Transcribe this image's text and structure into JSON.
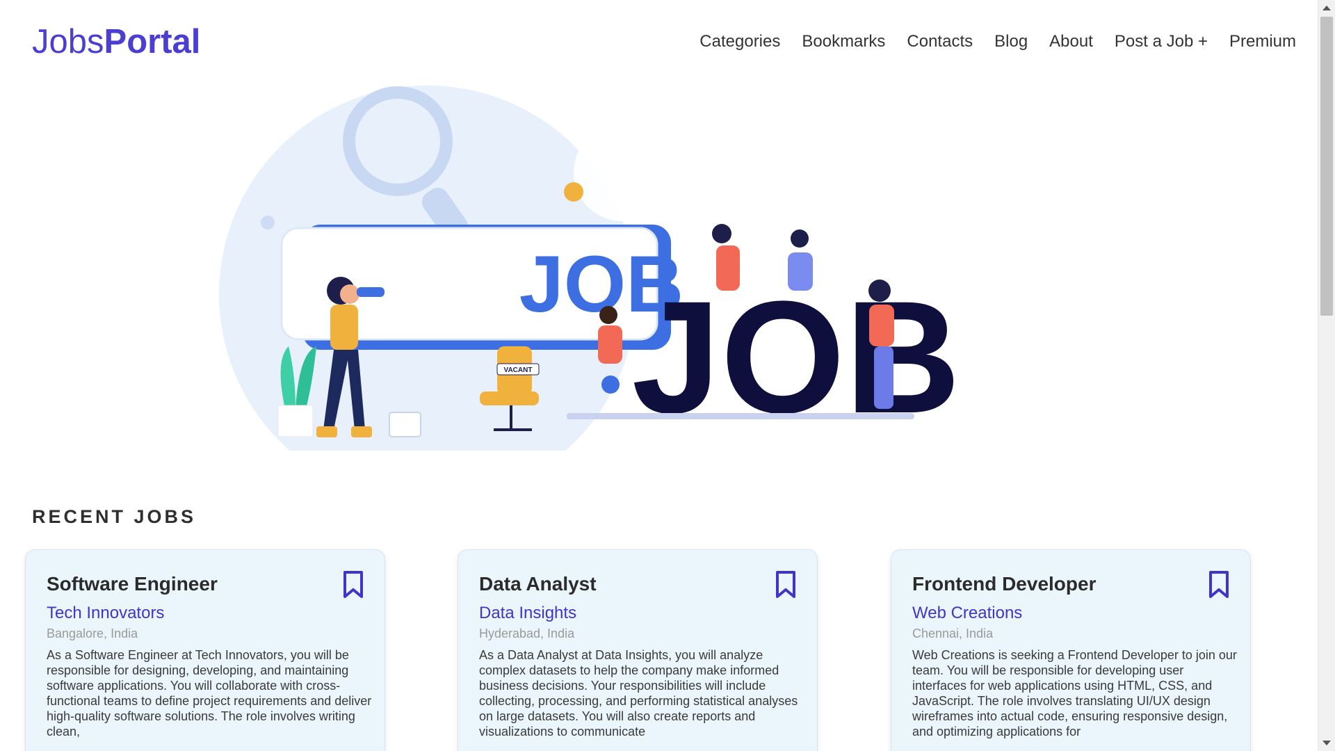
{
  "brand": {
    "part1": "Jobs",
    "part2": "Portal"
  },
  "nav": [
    {
      "label": "Categories"
    },
    {
      "label": "Bookmarks"
    },
    {
      "label": "Contacts"
    },
    {
      "label": "Blog"
    },
    {
      "label": "About"
    },
    {
      "label": "Post a Job +"
    },
    {
      "label": "Premium"
    }
  ],
  "hero": {
    "sign_text": "JOB",
    "big_text": "JOB",
    "chair_tag": "VACANT"
  },
  "recent_jobs": {
    "title": "RECENT JOBS",
    "jobs": [
      {
        "title": "Software Engineer",
        "company": "Tech Innovators",
        "location": "Bangalore, India",
        "description": "As a Software Engineer at Tech Innovators, you will be responsible for designing, developing, and maintaining software applications. You will collaborate with cross-functional teams to define project requirements and deliver high-quality software solutions. The role involves writing clean,"
      },
      {
        "title": "Data Analyst",
        "company": "Data Insights",
        "location": "Hyderabad, India",
        "description": "As a Data Analyst at Data Insights, you will analyze complex datasets to help the company make informed business decisions. Your responsibilities will include collecting, processing, and performing statistical analyses on large datasets. You will also create reports and visualizations to communicate"
      },
      {
        "title": "Frontend Developer",
        "company": "Web Creations",
        "location": "Chennai, India",
        "description": "Web Creations is seeking a Frontend Developer to join our team. You will be responsible for developing user interfaces for web applications using HTML, CSS, and JavaScript. The role involves translating UI/UX design wireframes into actual code, ensuring responsive design, and optimizing applications for"
      }
    ]
  },
  "colors": {
    "brand": "#4a3fd0",
    "company_link": "#3f35c9",
    "card_bg": "#eaf6fb",
    "bookmark": "#3f35c9",
    "hero_navy": "#0f0f3d",
    "hero_blue": "#3d6fe3"
  },
  "icons": {
    "bookmark": "bookmark-outline-icon"
  }
}
